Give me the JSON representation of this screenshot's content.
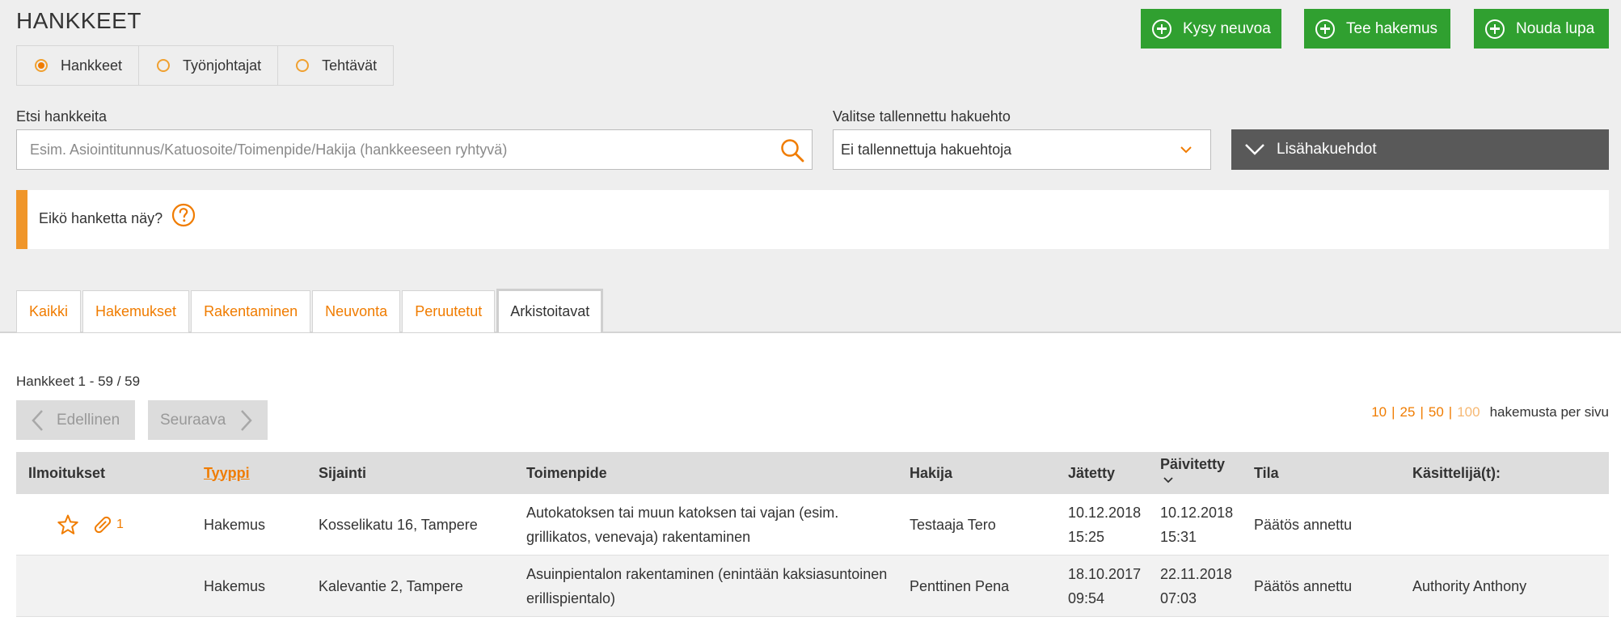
{
  "header": {
    "title": "HANKKEET"
  },
  "view_options": [
    {
      "label": "Hankkeet",
      "selected": true
    },
    {
      "label": "Työnjohtajat",
      "selected": false
    },
    {
      "label": "Tehtävät",
      "selected": false
    }
  ],
  "actions": {
    "ask_advice": "Kysy neuvoa",
    "make_application": "Tee hakemus",
    "get_permit": "Nouda lupa"
  },
  "search": {
    "label": "Etsi hankkeita",
    "placeholder": "Esim. Asiointitunnus/Katuosoite/Toimenpide/Hakija (hankkeeseen ryhtyvä)",
    "value": ""
  },
  "saved_search": {
    "label": "Valitse tallennettu hakuehto",
    "selected": "Ei tallennettuja hakuehtoja"
  },
  "more_filters": {
    "label": "Lisähakuehdot"
  },
  "notice": {
    "text": "Eikö hanketta näy?"
  },
  "tabs": [
    {
      "label": "Kaikki",
      "active": false
    },
    {
      "label": "Hakemukset",
      "active": false
    },
    {
      "label": "Rakentaminen",
      "active": false
    },
    {
      "label": "Neuvonta",
      "active": false
    },
    {
      "label": "Peruutetut",
      "active": false
    },
    {
      "label": "Arkistoitavat",
      "active": true
    }
  ],
  "results": {
    "count_text": "Hankkeet 1 - 59 / 59"
  },
  "pagination": {
    "previous": "Edellinen",
    "next": "Seuraava",
    "per_page_options": [
      "10",
      "25",
      "50",
      "100"
    ],
    "per_page_current": "100",
    "per_page_label": "hakemusta per sivu"
  },
  "table": {
    "columns": {
      "notifications": "Ilmoitukset",
      "type": "Tyyppi",
      "location": "Sijainti",
      "operation": "Toimenpide",
      "applicant": "Hakija",
      "submitted": "Jätetty",
      "updated": "Päivitetty",
      "state": "Tila",
      "handlers": "Käsittelijä(t):"
    },
    "rows": [
      {
        "starred": true,
        "attachment_count": "1",
        "type": "Hakemus",
        "location": "Kosselikatu 16, Tampere",
        "operation": "Autokatoksen tai muun katoksen tai vajan (esim. grillikatos, venevaja) rakentaminen",
        "applicant": "Testaaja Tero",
        "submitted_date": "10.12.2018",
        "submitted_time": "15:25",
        "updated_date": "10.12.2018",
        "updated_time": "15:31",
        "state": "Päätös annettu",
        "handlers": ""
      },
      {
        "starred": false,
        "attachment_count": "",
        "type": "Hakemus",
        "location": "Kalevantie 2, Tampere",
        "operation": "Asuinpientalon rakentaminen (enintään kaksiasuntoinen erillispientalo)",
        "applicant": "Penttinen Pena",
        "submitted_date": "18.10.2017",
        "submitted_time": "09:54",
        "updated_date": "22.11.2018",
        "updated_time": "07:03",
        "state": "Päätös annettu",
        "handlers": "Authority Anthony"
      }
    ]
  },
  "colors": {
    "accent_orange": "#f07c00",
    "green_button": "#30a030",
    "dark_button": "#595959"
  }
}
